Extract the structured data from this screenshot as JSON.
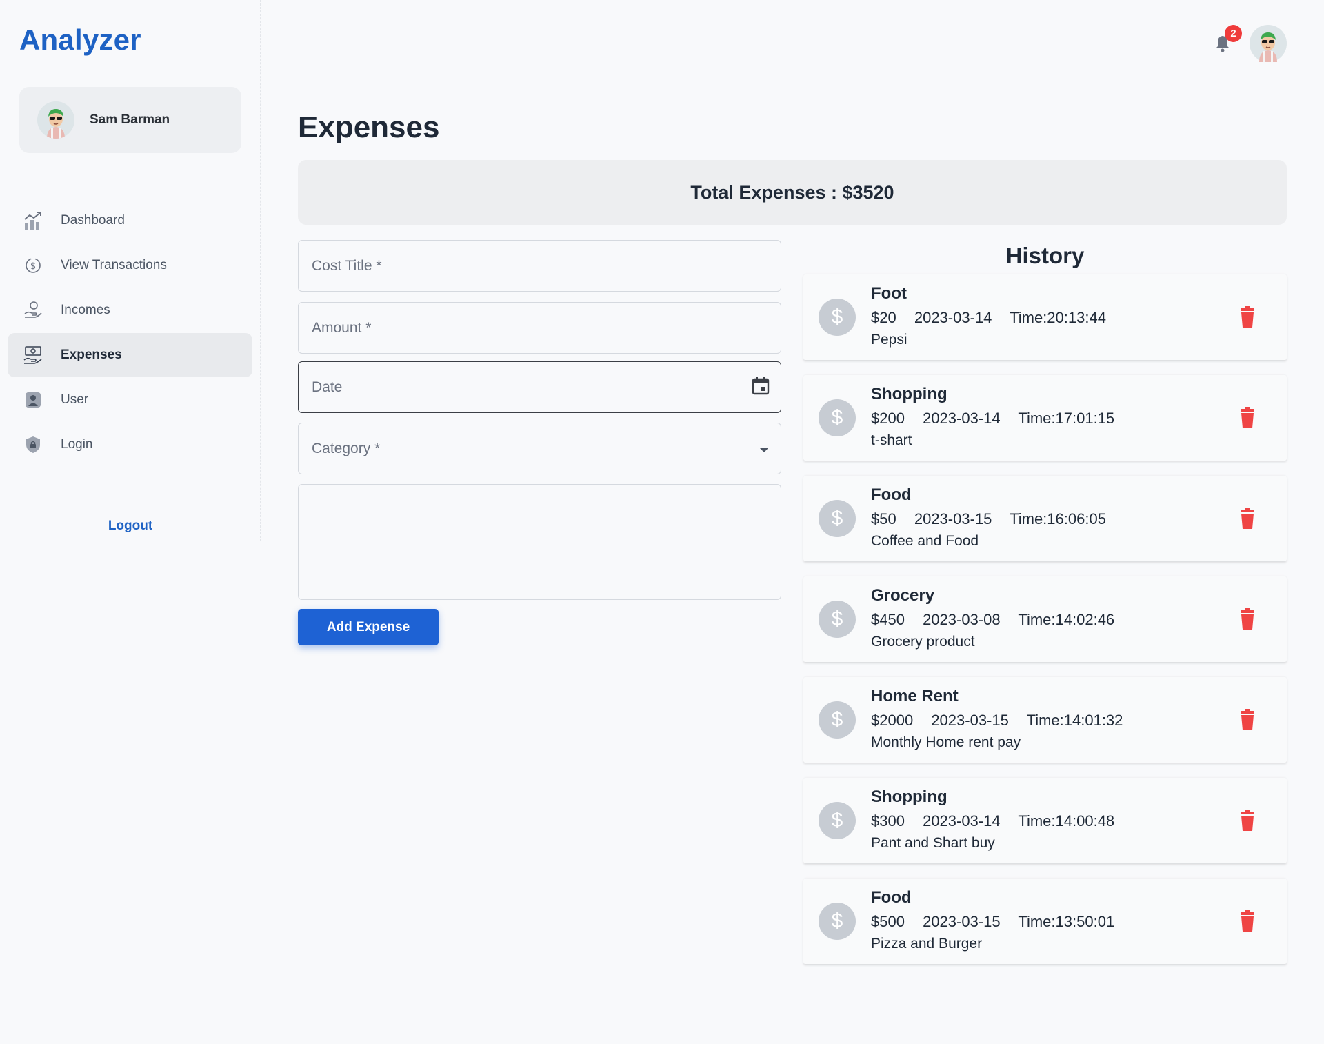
{
  "app": {
    "brand": "Analyzer"
  },
  "user": {
    "name": "Sam Barman"
  },
  "notifications": {
    "count": "2"
  },
  "sidebar": {
    "items": [
      {
        "label": "Dashboard",
        "icon": "chart-growth-icon",
        "active": false
      },
      {
        "label": "View Transactions",
        "icon": "dollar-cycle-icon",
        "active": false
      },
      {
        "label": "Incomes",
        "icon": "hand-coins-icon",
        "active": false
      },
      {
        "label": "Expenses",
        "icon": "cash-hand-icon",
        "active": true
      },
      {
        "label": "User",
        "icon": "user-icon",
        "active": false
      },
      {
        "label": "Login",
        "icon": "shield-lock-icon",
        "active": false
      }
    ],
    "logout_label": "Logout"
  },
  "main": {
    "title": "Expenses",
    "total_label": "Total Expenses : $3520"
  },
  "form": {
    "cost_title_placeholder": "Cost Title *",
    "amount_placeholder": "Amount *",
    "date_placeholder": "Date",
    "category_placeholder": "Category *",
    "description_value": "",
    "add_button_label": "Add Expense"
  },
  "history": {
    "title": "History",
    "items": [
      {
        "title": "Foot",
        "amount": "$20",
        "date": "2023-03-14",
        "time": "Time:20:13:44",
        "description": "Pepsi"
      },
      {
        "title": "Shopping",
        "amount": "$200",
        "date": "2023-03-14",
        "time": "Time:17:01:15",
        "description": "t-shart"
      },
      {
        "title": "Food",
        "amount": "$50",
        "date": "2023-03-15",
        "time": "Time:16:06:05",
        "description": "Coffee and Food"
      },
      {
        "title": "Grocery",
        "amount": "$450",
        "date": "2023-03-08",
        "time": "Time:14:02:46",
        "description": "Grocery product"
      },
      {
        "title": "Home Rent",
        "amount": "$2000",
        "date": "2023-03-15",
        "time": "Time:14:01:32",
        "description": "Monthly Home rent pay"
      },
      {
        "title": "Shopping",
        "amount": "$300",
        "date": "2023-03-14",
        "time": "Time:14:00:48",
        "description": "Pant and Shart buy"
      },
      {
        "title": "Food",
        "amount": "$500",
        "date": "2023-03-15",
        "time": "Time:13:50:01",
        "description": "Pizza and Burger"
      }
    ]
  },
  "colors": {
    "brand": "#1e62c4",
    "primary_button": "#1e62d4",
    "delete": "#ef4444",
    "badge": "#ef3b3b"
  }
}
